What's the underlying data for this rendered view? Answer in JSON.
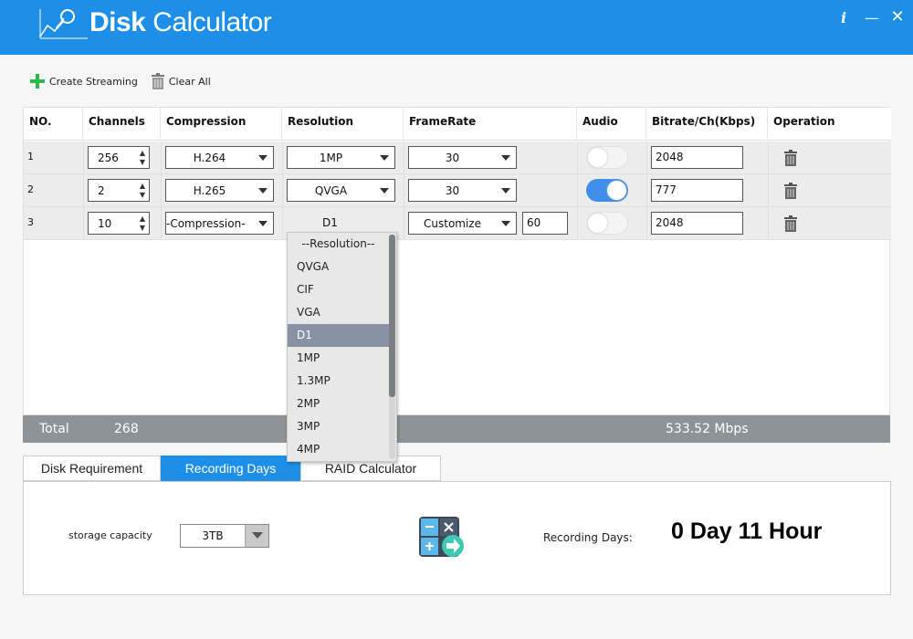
{
  "app": {
    "title_bold": "Disk",
    "title_light": " Calculator"
  },
  "window": {
    "info_icon": "info-icon",
    "minimize_icon": "minimize-icon",
    "close_icon": "close-icon"
  },
  "toolbar": {
    "create_label": "Create Streaming",
    "clear_label": "Clear All"
  },
  "table": {
    "headers": [
      "NO.",
      "Channels",
      "Compression",
      "Resolution",
      "FrameRate",
      "Audio",
      "Bitrate/Ch(Kbps)",
      "Operation"
    ],
    "rows": [
      {
        "no": "1",
        "channels": "256",
        "compression": "H.264",
        "resolution": "1MP",
        "framerate": "30",
        "audio_on": false,
        "bitrate": "2048"
      },
      {
        "no": "2",
        "channels": "2",
        "compression": "H.265",
        "resolution": "QVGA",
        "framerate": "30",
        "audio_on": true,
        "bitrate": "777"
      },
      {
        "no": "3",
        "channels": "10",
        "compression": "-Compression-",
        "resolution": "D1",
        "framerate": "Customize",
        "framerate_custom": "60",
        "audio_on": false,
        "bitrate": "2048"
      }
    ]
  },
  "resolution_dropdown": {
    "items": [
      "--Resolution--",
      "QVGA",
      "CIF",
      "VGA",
      "D1",
      "1MP",
      "1.3MP",
      "2MP",
      "3MP",
      "4MP"
    ],
    "highlighted": "D1"
  },
  "total": {
    "label": "Total",
    "channels": "268",
    "bitrate": "533.52 Mbps"
  },
  "tabs": [
    {
      "label": "Disk Requirement",
      "active": false
    },
    {
      "label": "Recording Days",
      "active": true
    },
    {
      "label": "RAID Calculator",
      "active": false
    }
  ],
  "recording": {
    "storage_label": "storage capacity",
    "storage_value": "3TB",
    "days_label": "Recording Days:",
    "result": "0 Day 11 Hour"
  },
  "colors": {
    "accent": "#1e8fe8",
    "total_bar": "#8e9397",
    "highlight": "#8892a4"
  }
}
